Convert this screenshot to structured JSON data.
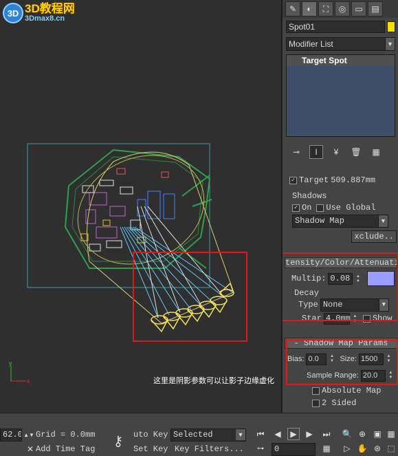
{
  "logo": {
    "mark": "3D",
    "title": "3D教程网",
    "url": "3Dmax8.cn"
  },
  "viewport": {
    "caption": "这里是阴影参数可以让影子边缘虚化",
    "axis_x": "x",
    "axis_y": "y"
  },
  "command_panel": {
    "tabs": [
      {
        "icon": "create-icon",
        "glyph": "✎"
      },
      {
        "icon": "modify-icon",
        "glyph": "◐"
      },
      {
        "icon": "hierarchy-icon",
        "glyph": "⛶"
      },
      {
        "icon": "motion-icon",
        "glyph": "◎"
      },
      {
        "icon": "display-icon",
        "glyph": "▭"
      },
      {
        "icon": "utilities-icon",
        "glyph": "▤"
      }
    ],
    "object_name": "Spot01",
    "object_color": "#f5e000",
    "modifier_list": "Modifier List",
    "stack_item": "Target Spot",
    "stack_tools": [
      {
        "icon": "pin-stack-icon",
        "glyph": "⊸"
      },
      {
        "icon": "show-end-result-icon",
        "glyph": "I"
      },
      {
        "icon": "make-unique-icon",
        "glyph": "¥"
      },
      {
        "icon": "remove-modifier-icon",
        "glyph": "🗑"
      },
      {
        "icon": "configure-sets-icon",
        "glyph": "▦"
      }
    ],
    "general": {
      "target_label": "Target",
      "target_value": "509.887mm"
    },
    "shadows": {
      "group_label": "Shadows",
      "on_label": "On",
      "use_global_label": "Use Global",
      "shadow_type": "Shadow Map",
      "exclude_label": "xclude.."
    },
    "intensity": {
      "title": "tensity/Color/Attenuati",
      "multiplier_label": "Multip:",
      "multiplier_value": "0.08",
      "swatch_color": "#9a9cff",
      "decay_label": "Decay",
      "type_label": "Type",
      "type_value": "None",
      "start_label": "Star",
      "start_value": "4.0mm",
      "show_label": "Show"
    },
    "shadow_map": {
      "title": "Shadow Map Params",
      "bias_label": "Bias:",
      "bias_value": "0.0",
      "size_label": "Size:",
      "size_value": "1500",
      "sample_range_label": "Sample Range:",
      "sample_range_value": "20.0",
      "absolute_map_label": "Absolute Map",
      "two_sided_label": "2 Sided"
    }
  },
  "status_bar": {
    "coord_value": "62.0",
    "grid_label": "Grid = 0.0mm",
    "add_time_tag": "Add Time Tag",
    "auto_key_label": "uto Key",
    "selected_value": "Selected",
    "set_key_label": "Set Key",
    "key_filters_label": "Key Filters...",
    "frame_value": "0",
    "playback": [
      {
        "icon": "go-to-start-icon",
        "glyph": "⏮"
      },
      {
        "icon": "previous-frame-icon",
        "glyph": "◀"
      },
      {
        "icon": "play-icon",
        "glyph": "▶"
      },
      {
        "icon": "next-frame-icon",
        "glyph": "▶"
      },
      {
        "icon": "go-to-end-icon",
        "glyph": "⏭"
      }
    ],
    "navigation": [
      {
        "icon": "zoom-icon",
        "glyph": "🔍"
      },
      {
        "icon": "zoom-all-icon",
        "glyph": "⊕"
      },
      {
        "icon": "zoom-extents-icon",
        "glyph": "▣"
      },
      {
        "icon": "zoom-extents-all-icon",
        "glyph": "▦"
      },
      {
        "icon": "field-of-view-icon",
        "glyph": "▷"
      },
      {
        "icon": "pan-icon",
        "glyph": "✋"
      },
      {
        "icon": "orbit-icon",
        "glyph": "⊛"
      },
      {
        "icon": "maximize-viewport-icon",
        "glyph": "⬚"
      }
    ]
  }
}
